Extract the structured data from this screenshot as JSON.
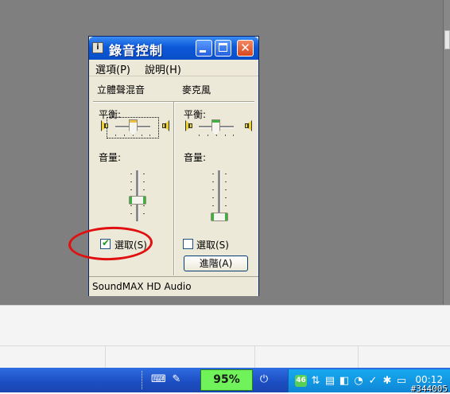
{
  "window": {
    "title": "錄音控制",
    "title_icon": "i",
    "menu": [
      {
        "label": "選項(P)"
      },
      {
        "label": "說明(H)"
      }
    ],
    "status": "SoundMAX HD Audio"
  },
  "channels": [
    {
      "name": "立體聲混音",
      "balance_label": "平衡:",
      "volume_label": "音量:",
      "select_label": "選取(S)",
      "selected": true,
      "volume_level": 0.45
    },
    {
      "name": "麥克風",
      "balance_label": "平衡:",
      "volume_label": "音量:",
      "select_label": "選取(S)",
      "selected": false,
      "volume_level": 0.1,
      "advanced_label": "進階(A)"
    }
  ],
  "taskbar": {
    "battery_percent": "95%",
    "notif_badge": "46",
    "clock": "00:12",
    "watermark": "#344005"
  },
  "colors": {
    "title_blue": "#0c58d8",
    "close_red": "#d9471c",
    "annotation_red": "#e01010",
    "battery_green": "#6ff25a"
  },
  "icons": [
    "info-icon",
    "minimize-icon",
    "maximize-icon",
    "close-icon",
    "speaker-left-icon",
    "speaker-right-icon",
    "checkbox-icon",
    "keyboard-icon",
    "pen-icon",
    "power-plug-icon",
    "network-icon",
    "tray-icon",
    "clock"
  ]
}
